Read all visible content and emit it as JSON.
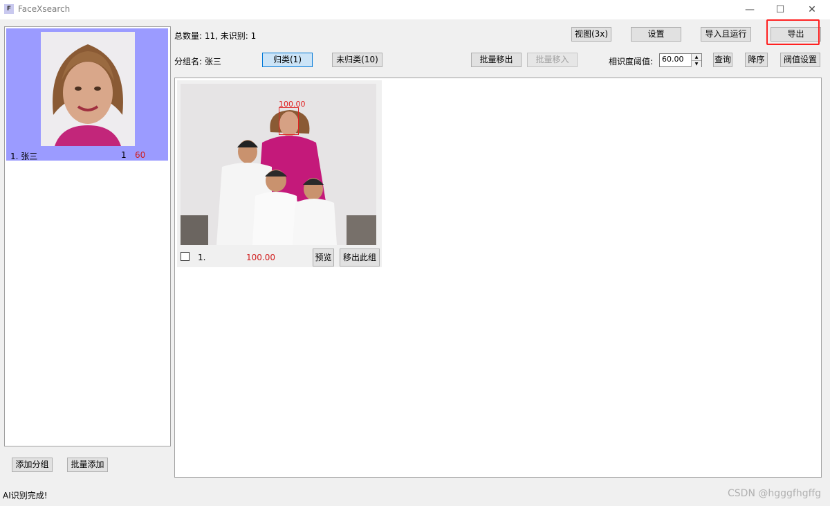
{
  "window": {
    "title": "FaceXsearch",
    "icon_letter": "F",
    "minimize_icon": "—",
    "maximize_icon": "☐",
    "close_icon": "✕"
  },
  "left_panel": {
    "groups": [
      {
        "name": "1.  张三",
        "count": "1",
        "threshold": "60"
      }
    ],
    "add_group_label": "添加分组",
    "batch_add_label": "批量添加"
  },
  "header": {
    "total_text": "总数量: 11, 未识别: 1",
    "group_label": "分组名: 张三",
    "threshold_label": "相识度阈值:",
    "threshold_value": "60.00"
  },
  "toolbar": {
    "view_label": "视图(3x)",
    "settings_label": "设置",
    "import_run_label": "导入且运行",
    "export_label": "导出",
    "classified_label": "归类(1)",
    "unclassified_label": "未归类(10)",
    "batch_remove_label": "批量移出",
    "batch_move_in_label": "批量移入",
    "query_label": "查询",
    "descending_label": "降序",
    "threshold_settings_label": "阀值设置"
  },
  "results": [
    {
      "index": "1.",
      "score": "100.00",
      "face_score": "100.00",
      "preview_label": "预览",
      "remove_label": "移出此组"
    }
  ],
  "status": {
    "text": "AI识别完成!"
  },
  "watermark": "CSDN @hgggfhgffg",
  "colors": {
    "group_selected": "#9b9bff",
    "score_red": "#d01a1a",
    "highlight": "#ff2020"
  }
}
